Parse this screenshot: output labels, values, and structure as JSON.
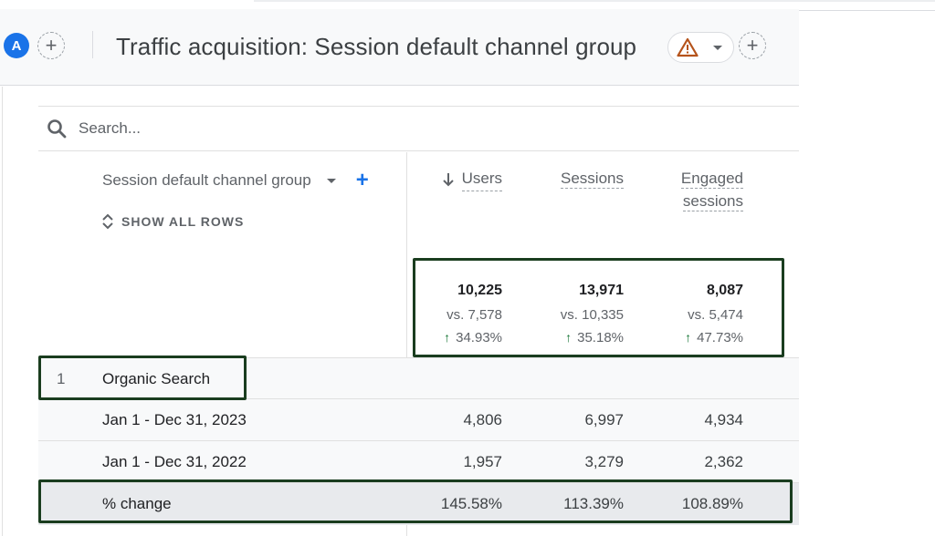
{
  "header": {
    "avatar_letter": "A",
    "title": "Traffic acquisition: Session default channel group",
    "add_comparison_icon": "plus-icon",
    "warning_icon": "warning-triangle-icon",
    "add_icon": "plus-icon"
  },
  "search": {
    "placeholder": "Search..."
  },
  "dimension": {
    "label": "Session default channel group",
    "add_label": "+",
    "show_all_rows": "SHOW ALL ROWS"
  },
  "metrics": {
    "columns": [
      {
        "key": "users",
        "label": "Users",
        "sorted": "descending"
      },
      {
        "key": "sessions",
        "label": "Sessions"
      },
      {
        "key": "engaged_sessions",
        "label_line1": "Engaged",
        "label_line2": "sessions"
      }
    ]
  },
  "totals": {
    "users": {
      "value": "10,225",
      "vs": "vs. 7,578",
      "change": "34.93%"
    },
    "sessions": {
      "value": "13,971",
      "vs": "vs. 10,335",
      "change": "35.18%"
    },
    "engaged_sessions": {
      "value": "8,087",
      "vs": "vs. 5,474",
      "change": "47.73%"
    }
  },
  "rows": [
    {
      "index": "1",
      "label": "Organic Search",
      "users": "",
      "sessions": "",
      "engaged_sessions": ""
    },
    {
      "index": "",
      "label": "Jan 1 - Dec 31, 2023",
      "users": "4,806",
      "sessions": "6,997",
      "engaged_sessions": "4,934"
    },
    {
      "index": "",
      "label": "Jan 1 - Dec 31, 2022",
      "users": "1,957",
      "sessions": "3,279",
      "engaged_sessions": "2,362"
    },
    {
      "index": "",
      "label": "% change",
      "users": "145.58%",
      "sessions": "113.39%",
      "engaged_sessions": "108.89%"
    }
  ],
  "colors": {
    "accent": "#1a73e8",
    "positive": "#137333",
    "warning": "#b06000",
    "highlight_border": "#1a3d1f"
  }
}
